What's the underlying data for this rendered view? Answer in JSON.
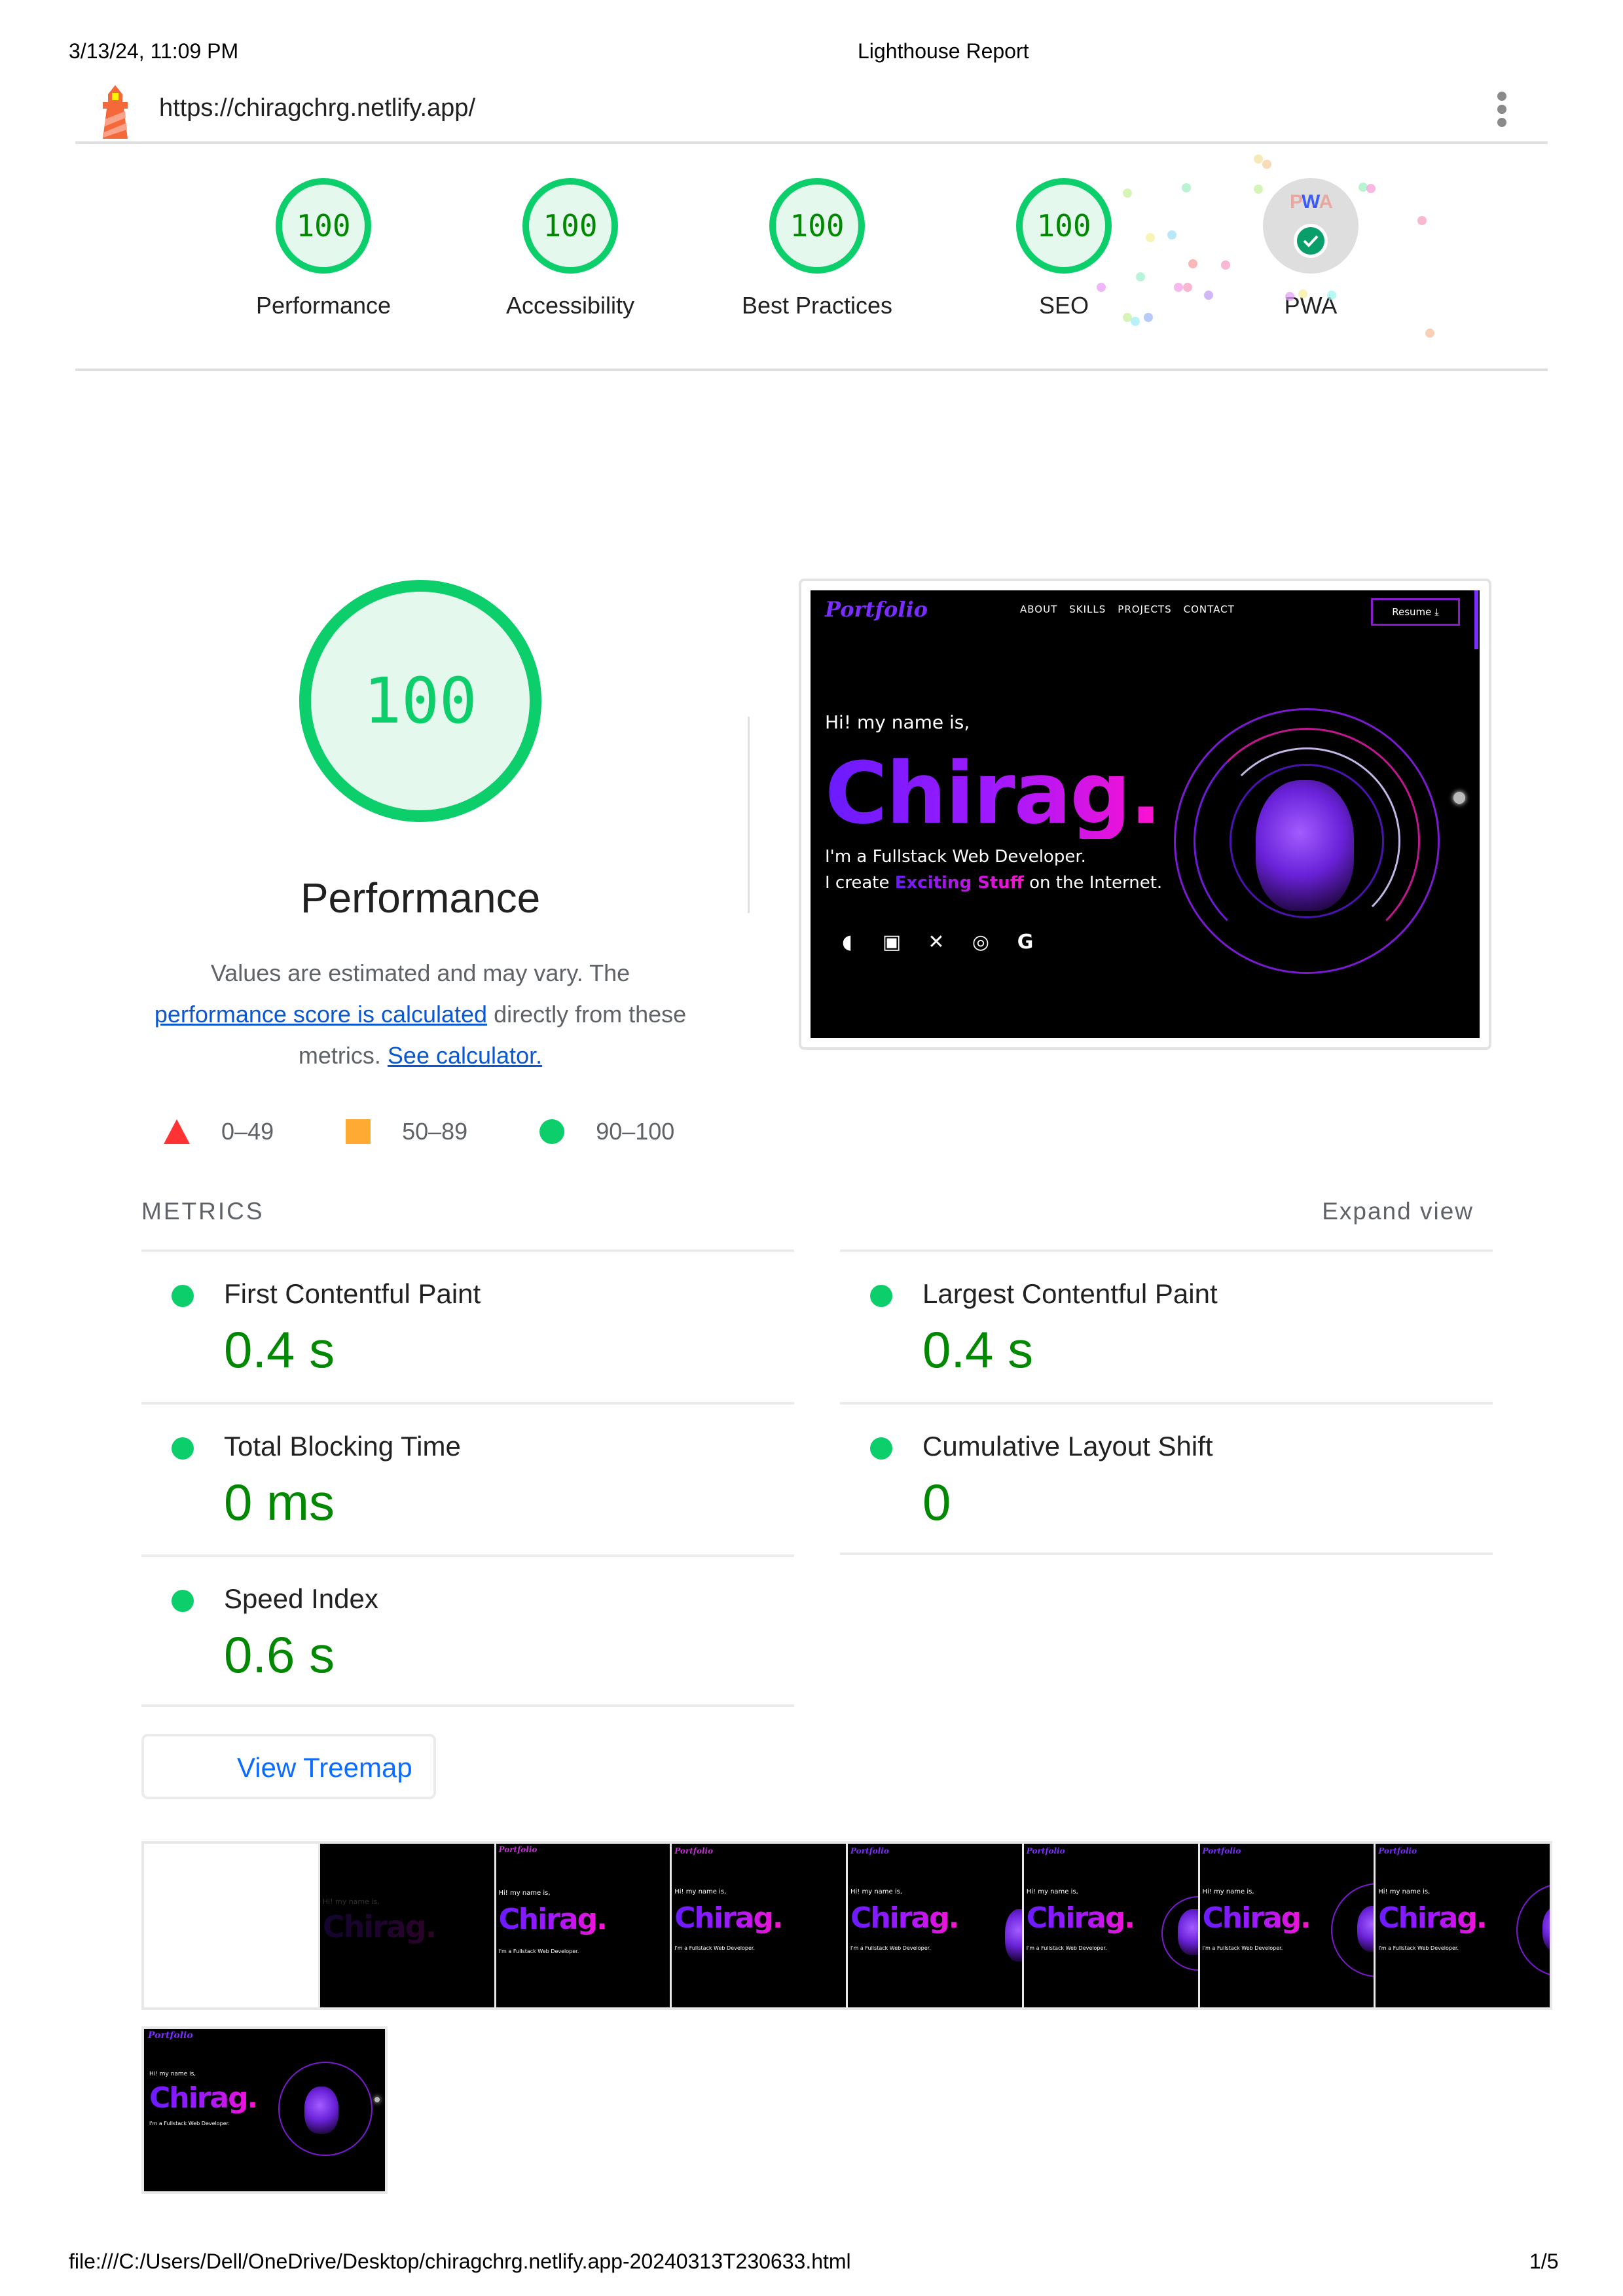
{
  "print_header": {
    "datetime": "3/13/24, 11:09 PM",
    "title": "Lighthouse Report"
  },
  "topbar": {
    "logo_icon": "lighthouse-icon",
    "url": "https://chiragchrg.netlify.app/",
    "menu_icon": "kebab-menu-icon"
  },
  "gauges": [
    {
      "label": "Performance",
      "score": "100"
    },
    {
      "label": "Accessibility",
      "score": "100"
    },
    {
      "label": "Best Practices",
      "score": "100"
    },
    {
      "label": "SEO",
      "score": "100"
    },
    {
      "label": "PWA",
      "score": null,
      "badge_text": "PWA",
      "badge_icon": "check-icon"
    }
  ],
  "performance": {
    "score": "100",
    "title": "Performance",
    "desc_prefix": "Values are estimated and may vary. The ",
    "desc_link1": "performance score is calculated",
    "desc_middle": " directly from these metrics. ",
    "desc_link2": "See calculator."
  },
  "legend": [
    {
      "icon": "triangle-fail-icon",
      "range": "0–49",
      "color": "#ff3333"
    },
    {
      "icon": "square-average-icon",
      "range": "50–89",
      "color": "#ffaa33"
    },
    {
      "icon": "circle-pass-icon",
      "range": "90–100",
      "color": "#0cce6b"
    }
  ],
  "metrics_section": {
    "header": "METRICS",
    "expand_label": "Expand view",
    "items": [
      {
        "name": "First Contentful Paint",
        "value": "0.4 s",
        "status": "pass"
      },
      {
        "name": "Largest Contentful Paint",
        "value": "0.4 s",
        "status": "pass"
      },
      {
        "name": "Total Blocking Time",
        "value": "0 ms",
        "status": "pass"
      },
      {
        "name": "Cumulative Layout Shift",
        "value": "0",
        "status": "pass"
      },
      {
        "name": "Speed Index",
        "value": "0.6 s",
        "status": "pass"
      }
    ]
  },
  "treemap_button": "View Treemap",
  "site_preview": {
    "logo": "Portfolio",
    "nav": [
      "ABOUT",
      "SKILLS",
      "PROJECTS",
      "CONTACT"
    ],
    "resume_button": "Resume ⤓",
    "greeting": "Hi! my name is,",
    "name": "Chirag.",
    "line1": "I'm a Fullstack Web Developer.",
    "line2_prefix": "I create ",
    "line2_highlight": "Exciting Stuff",
    "line2_suffix": " on the Internet.",
    "social_icons": [
      "github-icon",
      "linkedin-icon",
      "x-icon",
      "instagram-icon",
      "google-icon"
    ]
  },
  "filmstrip": {
    "frame_count": 9,
    "frames": [
      "blank",
      "fade-in",
      "nav-partial",
      "nav-partial",
      "portrait-partial",
      "orbit-partial",
      "full",
      "full-final",
      "full-final"
    ]
  },
  "colors": {
    "pass": "#0cce6b",
    "pass_text": "#008800",
    "pass_bg": "#e5f8ee",
    "link": "#0b57d0"
  },
  "print_footer": {
    "path": "file:///C:/Users/Dell/OneDrive/Desktop/chiragchrg.netlify.app-20240313T230633.html",
    "page": "1/5"
  }
}
